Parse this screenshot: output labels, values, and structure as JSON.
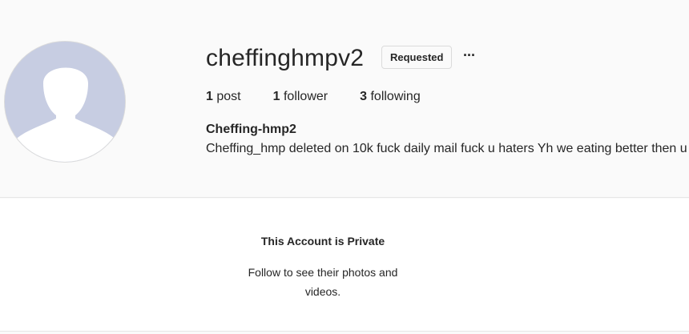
{
  "profile": {
    "username": "cheffinghmpv2",
    "follow_button_label": "Requested",
    "more_options_label": "···",
    "stats": [
      {
        "count": "1",
        "label": "post"
      },
      {
        "count": "1",
        "label": "follower"
      },
      {
        "count": "3",
        "label": "following"
      }
    ],
    "full_name": "Cheffing-hmp2",
    "bio": "Cheffing_hmp deleted on 10k fuck daily mail fuck u haters Yh we eating better then u",
    "avatar_icon": "default-avatar-icon"
  },
  "private_notice": {
    "title": "This Account is Private",
    "subtitle": "Follow to see their photos and videos."
  },
  "colors": {
    "avatar_bg": "#c7cde2",
    "text": "#262626",
    "border": "#dbdbdb"
  }
}
